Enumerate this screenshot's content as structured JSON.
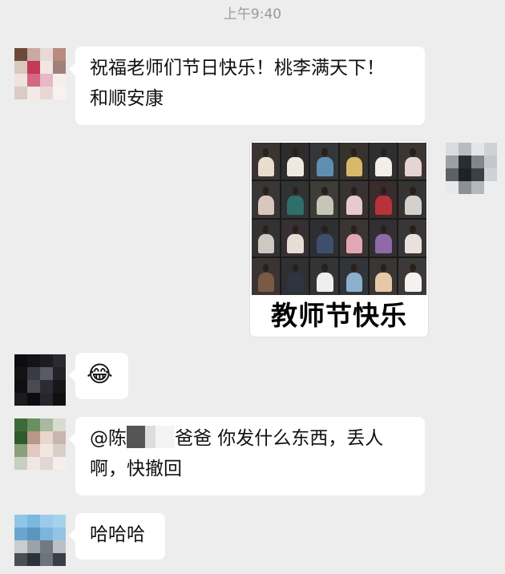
{
  "status": {
    "timestamp": "上午9:40"
  },
  "messages": [
    {
      "side": "left",
      "text": "祝福老师们节日快乐！桃李满天下！",
      "text_line2": "和顺安康"
    },
    {
      "side": "right",
      "type": "image",
      "caption": "教师节快乐"
    },
    {
      "side": "left",
      "type": "emoji",
      "emoji": "😂"
    },
    {
      "side": "left",
      "mention_prefix": "@陈",
      "mention_suffix": "爸爸 你发什么东西，丢人",
      "text_line2": "啊，快撤回"
    },
    {
      "side": "left",
      "text": "哈哈哈"
    }
  ],
  "icons": {
    "emoji_name": "laughing-tears-emoji"
  },
  "colors": {
    "background": "#ededed",
    "bubble": "#ffffff",
    "timestamp": "#9a9a9a"
  }
}
